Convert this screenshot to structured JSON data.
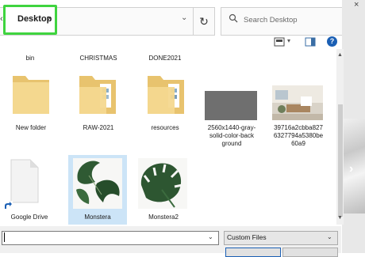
{
  "address_bar": {
    "location": "Desktop",
    "back_glyph": "‹",
    "chevron": "›",
    "dropdown_glyph": "⌄",
    "refresh_glyph": "↻",
    "search_placeholder": "Search Desktop"
  },
  "toolbar": {
    "help_label": "?",
    "view_drop": "▾"
  },
  "items": [
    {
      "label": "bin",
      "kind": "folder"
    },
    {
      "label": "CHRISTMAS",
      "kind": "folder"
    },
    {
      "label": "DONE2021",
      "kind": "folder"
    },
    {
      "label": "New folder",
      "kind": "folder"
    },
    {
      "label": "RAW-2021",
      "kind": "folder"
    },
    {
      "label": "resources",
      "kind": "folder"
    },
    {
      "label": "2560x1440-gray-solid-color-background",
      "label_lines": [
        "2560x1440-gray-",
        "solid-color-back",
        "ground"
      ],
      "kind": "image",
      "color": "#6f6f6f"
    },
    {
      "label": "39716a2cbba8276327794a5380be60a9",
      "label_lines": [
        "39716a2cbba827",
        "6327794a5380be",
        "60a9"
      ],
      "kind": "image"
    },
    {
      "label": "Google Drive",
      "kind": "shortcut"
    },
    {
      "label": "Monstera",
      "kind": "image",
      "selected": true
    },
    {
      "label": "Monstera2",
      "kind": "image"
    }
  ],
  "bottom": {
    "filename_value": "",
    "filetype_selected": "Custom Files",
    "dropdown_glyph": "⌄"
  },
  "right_panel": {
    "arrow_glyph": "›",
    "close_glyph": "×"
  },
  "colors": {
    "highlight": "#3fd43f",
    "folder": "#f2d48c",
    "selection": "#cce4f7",
    "accent": "#1a5fb4"
  }
}
